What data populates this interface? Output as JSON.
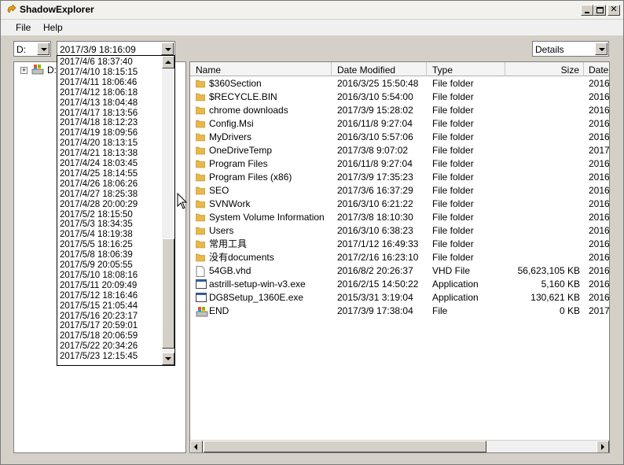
{
  "window": {
    "title": "ShadowExplorer"
  },
  "menu": {
    "file": "File",
    "help": "Help"
  },
  "toolbar": {
    "drive": "D:",
    "snapshot": "2017/3/9 18:16:09",
    "view": "Details"
  },
  "tree": {
    "root_label": "D:"
  },
  "snapshots": [
    "2017/4/6 18:37:40",
    "2017/4/10 18:15:15",
    "2017/4/11 18:06:46",
    "2017/4/12 18:06:18",
    "2017/4/13 18:04:48",
    "2017/4/17 18:13:56",
    "2017/4/18 18:12:23",
    "2017/4/19 18:09:56",
    "2017/4/20 18:13:15",
    "2017/4/21 18:13:38",
    "2017/4/24 18:03:45",
    "2017/4/25 18:14:55",
    "2017/4/26 18:06:26",
    "2017/4/27 18:25:38",
    "2017/4/28 20:00:29",
    "2017/5/2 18:15:50",
    "2017/5/3 18:34:35",
    "2017/5/4 18:19:38",
    "2017/5/5 18:16:25",
    "2017/5/8 18:06:39",
    "2017/5/9 20:05:55",
    "2017/5/10 18:08:16",
    "2017/5/11 20:09:49",
    "2017/5/12 18:16:46",
    "2017/5/15 21:05:44",
    "2017/5/16 20:23:17",
    "2017/5/17 20:59:01",
    "2017/5/18 20:06:59",
    "2017/5/22 20:34:26",
    "2017/5/23 12:15:45"
  ],
  "columns": {
    "name": "Name",
    "date_modified": "Date Modified",
    "type": "Type",
    "size": "Size",
    "date": "Date"
  },
  "files": [
    {
      "name": "$360Section",
      "modified": "2016/3/25 15:50:48",
      "type": "File folder",
      "size": "",
      "date": "2016/",
      "icon": "folder-icon"
    },
    {
      "name": "$RECYCLE.BIN",
      "modified": "2016/3/10 5:54:00",
      "type": "File folder",
      "size": "",
      "date": "2016/",
      "icon": "folder-icon"
    },
    {
      "name": "chrome downloads",
      "modified": "2017/3/9 15:28:02",
      "type": "File folder",
      "size": "",
      "date": "2016/",
      "icon": "folder-icon"
    },
    {
      "name": "Config.Msi",
      "modified": "2016/11/8 9:27:04",
      "type": "File folder",
      "size": "",
      "date": "2016/",
      "icon": "folder-icon"
    },
    {
      "name": "MyDrivers",
      "modified": "2016/3/10 5:57:06",
      "type": "File folder",
      "size": "",
      "date": "2016/",
      "icon": "folder-icon"
    },
    {
      "name": "OneDriveTemp",
      "modified": "2017/3/8 9:07:02",
      "type": "File folder",
      "size": "",
      "date": "2017/",
      "icon": "folder-icon"
    },
    {
      "name": "Program Files",
      "modified": "2016/11/8 9:27:04",
      "type": "File folder",
      "size": "",
      "date": "2016/",
      "icon": "folder-icon"
    },
    {
      "name": "Program Files (x86)",
      "modified": "2017/3/9 17:35:23",
      "type": "File folder",
      "size": "",
      "date": "2016/",
      "icon": "folder-icon"
    },
    {
      "name": "SEO",
      "modified": "2017/3/6 16:37:29",
      "type": "File folder",
      "size": "",
      "date": "2016/",
      "icon": "folder-icon"
    },
    {
      "name": "SVNWork",
      "modified": "2016/3/10 6:21:22",
      "type": "File folder",
      "size": "",
      "date": "2016/",
      "icon": "folder-icon"
    },
    {
      "name": "System Volume Information",
      "modified": "2017/3/8 18:10:30",
      "type": "File folder",
      "size": "",
      "date": "2016/",
      "icon": "folder-icon"
    },
    {
      "name": "Users",
      "modified": "2016/3/10 6:38:23",
      "type": "File folder",
      "size": "",
      "date": "2016/",
      "icon": "folder-icon"
    },
    {
      "name": "常用工具",
      "modified": "2017/1/12 16:49:33",
      "type": "File folder",
      "size": "",
      "date": "2016/",
      "icon": "folder-icon"
    },
    {
      "name": "没有documents",
      "modified": "2017/2/16 16:23:10",
      "type": "File folder",
      "size": "",
      "date": "2016/",
      "icon": "folder-icon"
    },
    {
      "name": "54GB.vhd",
      "modified": "2016/8/2 20:26:37",
      "type": "VHD File",
      "size": "56,623,105 KB",
      "date": "2016/",
      "icon": "file-icon"
    },
    {
      "name": "astrill-setup-win-v3.exe",
      "modified": "2016/2/15 14:50:22",
      "type": "Application",
      "size": "5,160 KB",
      "date": "2016/",
      "icon": "exe-icon"
    },
    {
      "name": "DG8Setup_1360E.exe",
      "modified": "2015/3/31 3:19:04",
      "type": "Application",
      "size": "130,621 KB",
      "date": "2016/",
      "icon": "exe-icon"
    },
    {
      "name": "END",
      "modified": "2017/3/9 17:38:04",
      "type": "File",
      "size": "0 KB",
      "date": "2017/",
      "icon": "drive-file-icon"
    }
  ],
  "colors": {
    "folder": "#e8b84a",
    "window_bg": "#d4d0c8"
  }
}
